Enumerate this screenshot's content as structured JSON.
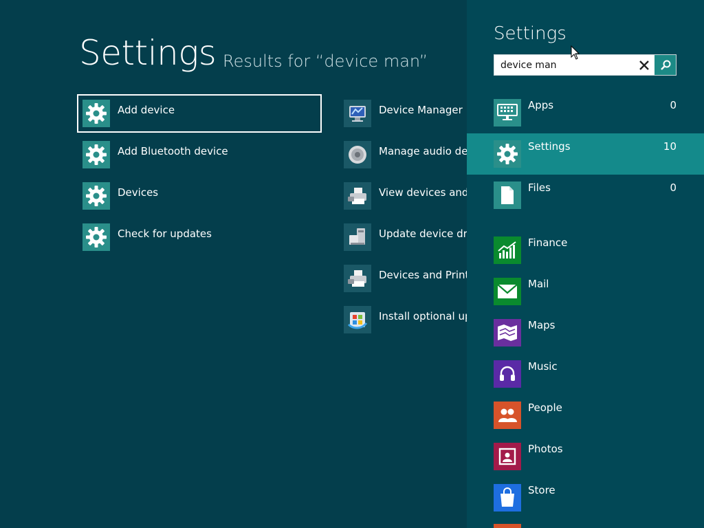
{
  "header": {
    "title": "Settings",
    "results_for": "Results for “device man”"
  },
  "results_left": [
    {
      "label": "Add device",
      "icon": "gear-icon",
      "selected": true
    },
    {
      "label": "Add Bluetooth device",
      "icon": "gear-icon"
    },
    {
      "label": "Devices",
      "icon": "gear-icon"
    },
    {
      "label": "Check for updates",
      "icon": "gear-icon"
    }
  ],
  "results_right": [
    {
      "label": "Device Manager",
      "icon": "device-manager-icon"
    },
    {
      "label": "Manage audio devices",
      "icon": "speaker-icon"
    },
    {
      "label": "View devices and printers",
      "icon": "printer-icon"
    },
    {
      "label": "Update device drivers",
      "icon": "device-driver-icon"
    },
    {
      "label": "Devices and Printers",
      "icon": "printer-icon"
    },
    {
      "label": "Install optional updates",
      "icon": "windows-update-icon"
    }
  ],
  "pane": {
    "title": "Settings",
    "search": {
      "value": "device man",
      "placeholder": ""
    },
    "scopes": [
      {
        "label": "Apps",
        "count": "0",
        "icon": "keyboard-icon",
        "active": false
      },
      {
        "label": "Settings",
        "count": "10",
        "icon": "gear-icon",
        "active": true
      },
      {
        "label": "Files",
        "count": "0",
        "icon": "file-icon",
        "active": false
      }
    ],
    "apps": [
      {
        "label": "Finance",
        "icon": "finance-chart-icon",
        "color": "#0a8a2e"
      },
      {
        "label": "Mail",
        "icon": "mail-icon",
        "color": "#0a8a2e"
      },
      {
        "label": "Maps",
        "icon": "map-icon",
        "color": "#6a2f9e"
      },
      {
        "label": "Music",
        "icon": "headphones-icon",
        "color": "#5a2aa6"
      },
      {
        "label": "People",
        "icon": "people-icon",
        "color": "#d7532a"
      },
      {
        "label": "Photos",
        "icon": "photo-icon",
        "color": "#a31a4a"
      },
      {
        "label": "Store",
        "icon": "shopping-bag-icon",
        "color": "#1e6ee0"
      }
    ]
  },
  "colors": {
    "background": "#043e4c",
    "pane_background": "#024856",
    "active_scope": "#148a8b",
    "accent_teal": "#2a8f8a"
  }
}
